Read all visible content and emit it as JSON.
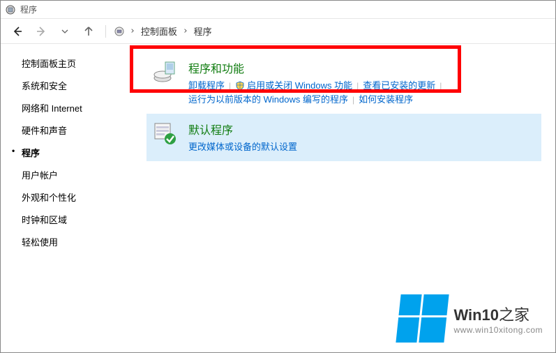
{
  "window": {
    "title": "程序"
  },
  "nav": {
    "breadcrumb": {
      "items": [
        "控制面板",
        "程序"
      ]
    }
  },
  "sidebar": {
    "items": [
      {
        "label": "控制面板主页",
        "active": false
      },
      {
        "label": "系统和安全",
        "active": false
      },
      {
        "label": "网络和 Internet",
        "active": false
      },
      {
        "label": "硬件和声音",
        "active": false
      },
      {
        "label": "程序",
        "active": true
      },
      {
        "label": "用户帐户",
        "active": false
      },
      {
        "label": "外观和个性化",
        "active": false
      },
      {
        "label": "时钟和区域",
        "active": false
      },
      {
        "label": "轻松使用",
        "active": false
      }
    ]
  },
  "main": {
    "section1": {
      "title": "程序和功能",
      "links": {
        "l1": "卸载程序",
        "l2": "启用或关闭 Windows 功能",
        "l3": "查看已安装的更新",
        "l4": "运行为以前版本的 Windows 编写的程序",
        "l5": "如何安装程序"
      }
    },
    "section2": {
      "title": "默认程序",
      "links": {
        "l1": "更改媒体或设备的默认设置"
      }
    }
  },
  "watermark": {
    "brand_prefix": "Win10",
    "brand_suffix": "之家",
    "url": "www.win10xitong.com"
  }
}
